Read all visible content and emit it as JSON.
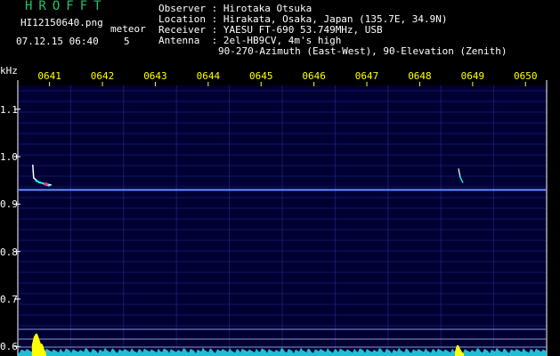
{
  "header": {
    "app_title": "HROFFT",
    "filename": "HI12150640.png",
    "datetime": "07.12.15 06:40",
    "meteor_label": "meteor",
    "meteor_count": "5"
  },
  "info": {
    "observer_label": "Observer",
    "observer": "Hirotaka Otsuka",
    "location_label": "Location",
    "location": "Hirakata, Osaka, Japan (135.7E, 34.9N)",
    "receiver_label": "Receiver",
    "receiver": "YAESU FT-690 53.749MHz, USB",
    "antenna_label": "Antenna",
    "antenna_line1": "2el-HB9CV, 4m's high",
    "antenna_line2": "90-270-Azimuth (East-West), 90-Elevation (Zenith)"
  },
  "colors": {
    "background": "#000033",
    "title": "#22c36a",
    "ticks": "#ffff00",
    "text": "#ffffff",
    "echo": "#00ffff",
    "power": "#ffff00",
    "noise_floor": "#22d3e6"
  },
  "chart_data": {
    "type": "heatmap",
    "y_unit": "kHz",
    "x_ticks": [
      "0641",
      "0642",
      "0643",
      "0644",
      "0645",
      "0646",
      "0647",
      "0648",
      "0649",
      "0650"
    ],
    "y_ticks": [
      "1.1",
      "1.0",
      "0.9",
      "0.8",
      "0.7",
      "0.6"
    ],
    "x_range": [
      "06:40",
      "06:50"
    ],
    "y_range": [
      0.58,
      1.15
    ],
    "grid": true,
    "carrier_khz": 0.93,
    "meteor_echoes": [
      {
        "time": "06:40:20",
        "freq_khz": 0.955,
        "strength": "strong"
      },
      {
        "time": "06:48:20",
        "freq_khz": 0.96,
        "strength": "weak"
      }
    ]
  }
}
